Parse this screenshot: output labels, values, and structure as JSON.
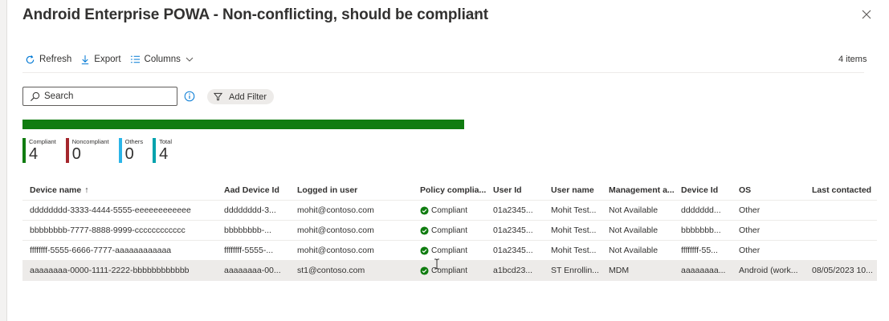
{
  "page": {
    "title": "Android Enterprise POWA - Non-conflicting, should be compliant",
    "more_label": "···"
  },
  "toolbar": {
    "refresh_label": "Refresh",
    "export_label": "Export",
    "columns_label": "Columns",
    "items_count": "4 items"
  },
  "filters": {
    "search_placeholder": "Search",
    "add_filter_label": "Add Filter"
  },
  "summary": {
    "bar": [
      {
        "name": "Compliant",
        "fraction": 1.0,
        "color": "#107c10"
      },
      {
        "name": "Noncompliant",
        "fraction": 0.0,
        "color": "#a4262c"
      },
      {
        "name": "Others",
        "fraction": 0.0,
        "color": "#2bb5e8"
      }
    ],
    "stats": [
      {
        "label": "Compliant",
        "value": "4",
        "color": "#107c10"
      },
      {
        "label": "Noncompliant",
        "value": "0",
        "color": "#a4262c"
      },
      {
        "label": "Others",
        "value": "0",
        "color": "#2bb5e8"
      },
      {
        "label": "Total",
        "value": "4",
        "color": "#00a2ad"
      }
    ]
  },
  "grid": {
    "columns": [
      "Device name",
      "Aad Device Id",
      "Logged in user",
      "Policy complia...",
      "User Id",
      "User name",
      "Management a...",
      "Device Id",
      "OS",
      "Last contacted"
    ],
    "sort_indicator": "↑",
    "rows": [
      [
        "dddddddd-3333-4444-5555-eeeeeeeeeeee",
        "dddddddd-3...",
        "mohit@contoso.com",
        "Compliant",
        "01a2345...",
        "Mohit Test...",
        "Not Available",
        "ddddddd...",
        "Other",
        ""
      ],
      [
        "bbbbbbbb-7777-8888-9999-cccccccccccc",
        "bbbbbbbb-...",
        "mohit@contoso.com",
        "Compliant",
        "01a2345...",
        "Mohit Test...",
        "Not Available",
        "bbbbbbb...",
        "Other",
        ""
      ],
      [
        "ffffffff-5555-6666-7777-aaaaaaaaaaaa",
        "ffffffff-5555-...",
        "mohit@contoso.com",
        "Compliant",
        "01a2345...",
        "Mohit Test...",
        "Not Available",
        "ffffffff-55...",
        "Other",
        ""
      ],
      [
        "aaaaaaaa-0000-1111-2222-bbbbbbbbbbbb",
        "aaaaaaaa-00...",
        "st1@contoso.com",
        "Compliant",
        "a1bcd23...",
        "ST Enrollin...",
        "MDM",
        "aaaaaaaa...",
        "Android (work...",
        "08/05/2023 10..."
      ]
    ],
    "selected_row": 3
  },
  "colors": {
    "compliant_check": "#107c10",
    "accent": "#0078d4"
  }
}
